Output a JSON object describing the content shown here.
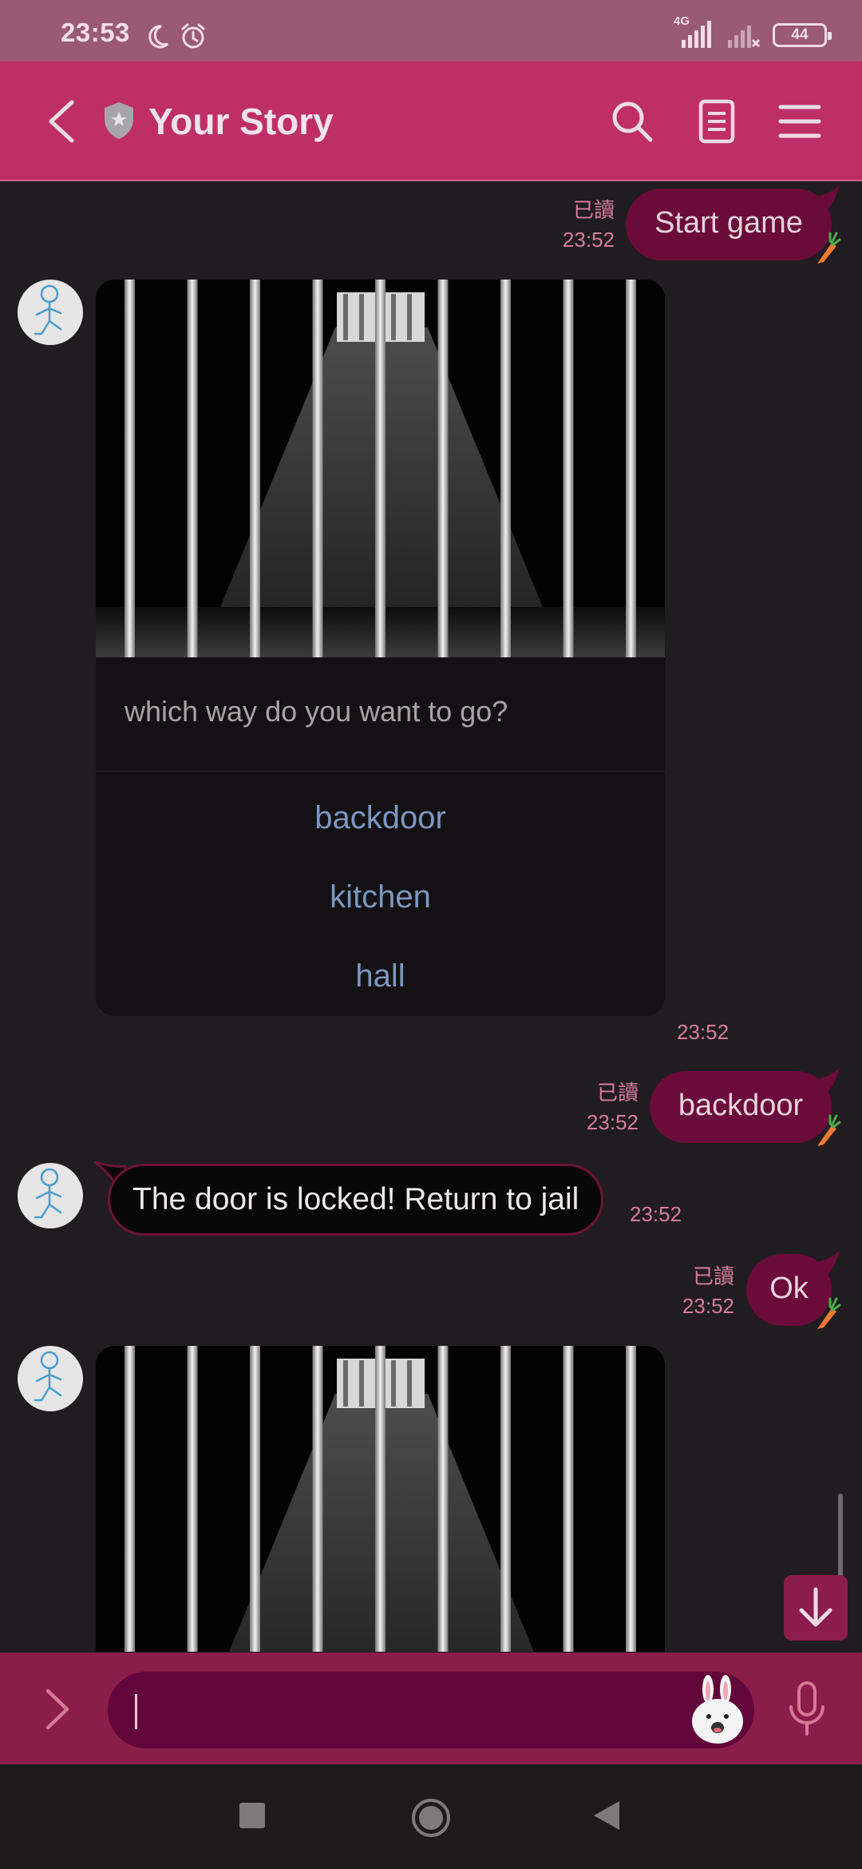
{
  "status_bar": {
    "time": "23:53",
    "network": "4G",
    "battery": "44"
  },
  "header": {
    "title": "Your Story"
  },
  "messages": {
    "start": {
      "read": "已讀",
      "time": "23:52",
      "text": "Start game"
    },
    "card1": {
      "question": "which way do you want to go?",
      "options": [
        "backdoor",
        "kitchen",
        "hall"
      ],
      "time": "23:52"
    },
    "backdoor": {
      "read": "已讀",
      "time": "23:52",
      "text": "backdoor"
    },
    "locked": {
      "text": "The door is locked! Return to jail",
      "time": "23:52"
    },
    "ok": {
      "read": "已讀",
      "time": "23:52",
      "text": "Ok"
    }
  },
  "input": {
    "value": ""
  },
  "colors": {
    "header": "#be2f68",
    "status_bar": "#9a5a73",
    "outgoing_bubble": "#6b0b3a",
    "chat_background": "#211c1f",
    "option_link": "#7c97c0",
    "meta_text": "#d77d9c",
    "input_bar": "#8a1d49"
  },
  "icons": {
    "back": "chevron-left-icon",
    "badge": "shield-icon",
    "search": "search-icon",
    "notes": "note-icon",
    "menu": "hamburger-menu-icon",
    "scroll": "arrow-down-icon",
    "expand": "chevron-right-icon",
    "sticker": "rabbit-sticker-icon",
    "mic": "microphone-icon"
  }
}
